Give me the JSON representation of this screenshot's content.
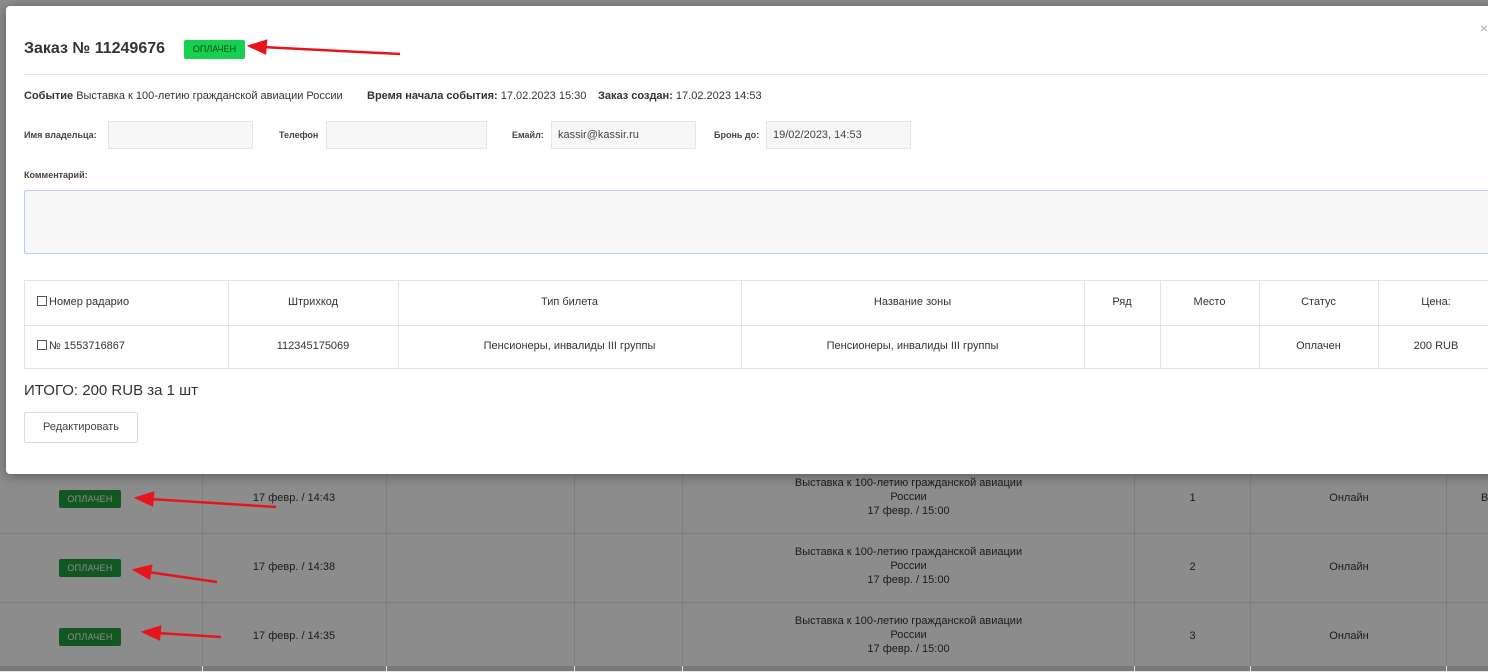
{
  "order": {
    "title": "Заказ № 11249676",
    "status": "ОПЛАЧЕН",
    "close_icon": "×",
    "event_label": "Событие",
    "event_value": "Выставка к 100-летию гражданской авиации России",
    "start_label": "Время начала события:",
    "start_value": "17.02.2023 15:30",
    "created_label": "Заказ создан:",
    "created_value": "17.02.2023 14:53"
  },
  "form": {
    "owner_label": "Имя владельца:",
    "owner_value": "",
    "phone_label": "Телефон",
    "phone_value": "",
    "email_label": "Емайл:",
    "email_value": "kassir@kassir.ru",
    "reserve_label": "Бронь до:",
    "reserve_value": "19/02/2023, 14:53",
    "comment_label": "Комментарий:",
    "comment_value": ""
  },
  "tickets": {
    "headers": [
      "Номер радарио",
      "Штрихкод",
      "Тип билета",
      "Название зоны",
      "Ряд",
      "Место",
      "Статус",
      "Цена:"
    ],
    "rows": [
      [
        "№ 1553716867",
        "112345175069",
        "Пенсионеры, инвалиды III группы",
        "Пенсионеры, инвалиды III группы",
        "",
        "",
        "Оплачен",
        "200 RUB"
      ]
    ]
  },
  "summary": {
    "total": "ИТОГО: 200 RUB за 1 шт",
    "edit_label": "Редактировать"
  },
  "background_list": {
    "rows": [
      {
        "status": "ОПЛАЧЕН",
        "date": "17 февр. / 14:43",
        "event_line1": "Выставка к 100-летию гражданской авиации",
        "event_line2": "России",
        "event_date": "17 февр. / 15:00",
        "num": "1",
        "channel": "Онлайн",
        "edge": "В"
      },
      {
        "status": "ОПЛАЧЕН",
        "date": "17 февр. / 14:38",
        "event_line1": "Выставка к 100-летию гражданской авиации",
        "event_line2": "России",
        "event_date": "17 февр. / 15:00",
        "num": "2",
        "channel": "Онлайн",
        "edge": ""
      },
      {
        "status": "ОПЛАЧЕН",
        "date": "17 февр. / 14:35",
        "event_line1": "Выставка к 100-летию гражданской авиации",
        "event_line2": "России",
        "event_date": "17 февр. / 15:00",
        "num": "3",
        "channel": "Онлайн",
        "edge": ""
      }
    ]
  },
  "colors": {
    "status_green": "#17d14e",
    "badge_green": "#1e9e3e",
    "arrow_red": "#e8141b"
  }
}
